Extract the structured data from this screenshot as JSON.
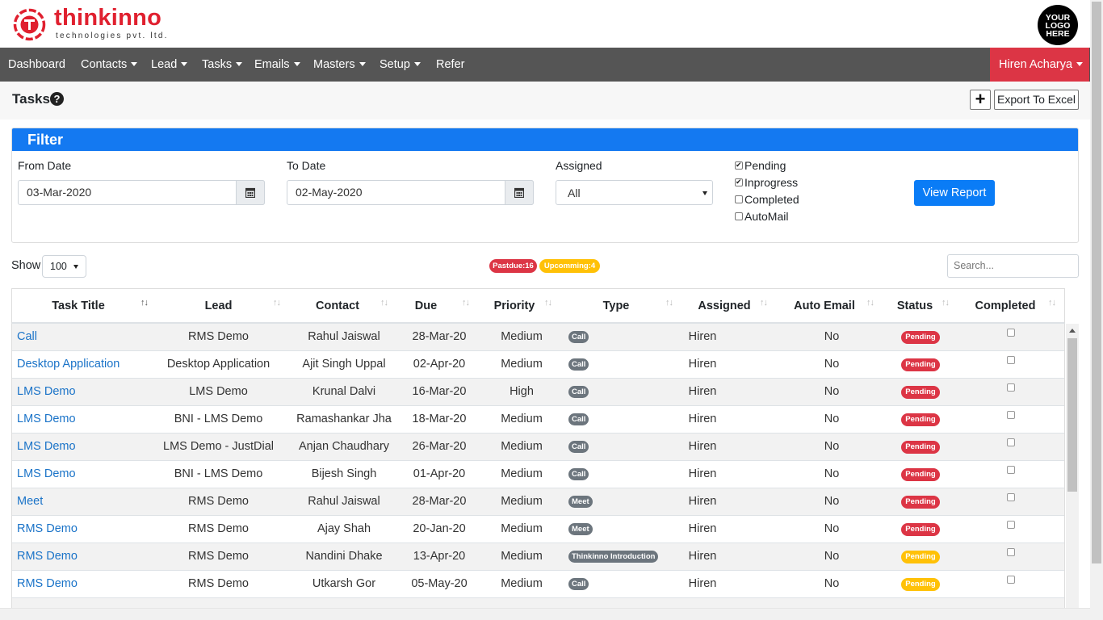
{
  "brand": {
    "name": "thinkinno",
    "sub": "technologies pvt. ltd.",
    "client_logo": "YOUR LOGO HERE"
  },
  "nav": {
    "items": [
      {
        "label": "Dashboard",
        "dropdown": false
      },
      {
        "label": "Contacts",
        "dropdown": true
      },
      {
        "label": "Lead",
        "dropdown": true
      },
      {
        "label": "Tasks",
        "dropdown": true
      },
      {
        "label": "Emails",
        "dropdown": true
      },
      {
        "label": "Masters",
        "dropdown": true
      },
      {
        "label": "Setup",
        "dropdown": true
      },
      {
        "label": "Refer",
        "dropdown": false
      }
    ],
    "user": "Hiren Acharya"
  },
  "page": {
    "title": "Tasks",
    "add_label": "+",
    "export_label": "Export To Excel"
  },
  "filter": {
    "heading": "Filter",
    "from_label": "From Date",
    "from_value": "03-Mar-2020",
    "to_label": "To Date",
    "to_value": "02-May-2020",
    "assigned_label": "Assigned",
    "assigned_value": "All",
    "checks": [
      {
        "label": "Pending",
        "checked": true
      },
      {
        "label": "Inprogress",
        "checked": true
      },
      {
        "label": "Completed",
        "checked": false
      },
      {
        "label": "AutoMail",
        "checked": false
      }
    ],
    "view_label": "View Report"
  },
  "list": {
    "show_label": "Show",
    "show_value": "100",
    "pastdue": "Pastdue:16",
    "upcoming": "Upcomming:4",
    "search_placeholder": "Search..."
  },
  "table": {
    "columns": [
      "Task Title",
      "Lead",
      "Contact",
      "Due",
      "Priority",
      "Type",
      "Assigned",
      "Auto Email",
      "Status",
      "Completed"
    ],
    "rows": [
      {
        "title": "Call",
        "lead": "RMS Demo",
        "contact": "Rahul Jaiswal",
        "due": "28-Mar-20",
        "priority": "Medium",
        "type": "Call",
        "assigned": "Hiren",
        "auto": "No",
        "status": "Pending",
        "status_color": "red"
      },
      {
        "title": "Desktop Application",
        "lead": "Desktop Application",
        "contact": "Ajit Singh Uppal",
        "due": "02-Apr-20",
        "priority": "Medium",
        "type": "Call",
        "assigned": "Hiren",
        "auto": "No",
        "status": "Pending",
        "status_color": "red"
      },
      {
        "title": "LMS Demo",
        "lead": "LMS Demo",
        "contact": "Krunal Dalvi",
        "due": "16-Mar-20",
        "priority": "High",
        "type": "Call",
        "assigned": "Hiren",
        "auto": "No",
        "status": "Pending",
        "status_color": "red"
      },
      {
        "title": "LMS Demo",
        "lead": "BNI - LMS Demo",
        "contact": "Ramashankar Jha",
        "due": "18-Mar-20",
        "priority": "Medium",
        "type": "Call",
        "assigned": "Hiren",
        "auto": "No",
        "status": "Pending",
        "status_color": "red"
      },
      {
        "title": "LMS Demo",
        "lead": "LMS Demo - JustDial",
        "contact": "Anjan Chaudhary",
        "due": "26-Mar-20",
        "priority": "Medium",
        "type": "Call",
        "assigned": "Hiren",
        "auto": "No",
        "status": "Pending",
        "status_color": "red"
      },
      {
        "title": "LMS Demo",
        "lead": "BNI - LMS Demo",
        "contact": "Bijesh Singh",
        "due": "01-Apr-20",
        "priority": "Medium",
        "type": "Call",
        "assigned": "Hiren",
        "auto": "No",
        "status": "Pending",
        "status_color": "red"
      },
      {
        "title": "Meet",
        "lead": "RMS Demo",
        "contact": "Rahul Jaiswal",
        "due": "28-Mar-20",
        "priority": "Medium",
        "type": "Meet",
        "assigned": "Hiren",
        "auto": "No",
        "status": "Pending",
        "status_color": "red"
      },
      {
        "title": "RMS Demo",
        "lead": "RMS Demo",
        "contact": "Ajay Shah",
        "due": "20-Jan-20",
        "priority": "Medium",
        "type": "Meet",
        "assigned": "Hiren",
        "auto": "No",
        "status": "Pending",
        "status_color": "red"
      },
      {
        "title": "RMS Demo",
        "lead": "RMS Demo",
        "contact": "Nandini Dhake",
        "due": "13-Apr-20",
        "priority": "Medium",
        "type": "Thinkinno Introduction",
        "assigned": "Hiren",
        "auto": "No",
        "status": "Pending",
        "status_color": "yellow"
      },
      {
        "title": "RMS Demo",
        "lead": "RMS Demo",
        "contact": "Utkarsh Gor",
        "due": "05-May-20",
        "priority": "Medium",
        "type": "Call",
        "assigned": "Hiren",
        "auto": "No",
        "status": "Pending",
        "status_color": "yellow"
      }
    ]
  },
  "colors": {
    "nav": "#555555",
    "accent_red": "#dc3545",
    "filter_blue": "#1479f1",
    "link": "#1a73c8",
    "warning": "#ffc107"
  }
}
